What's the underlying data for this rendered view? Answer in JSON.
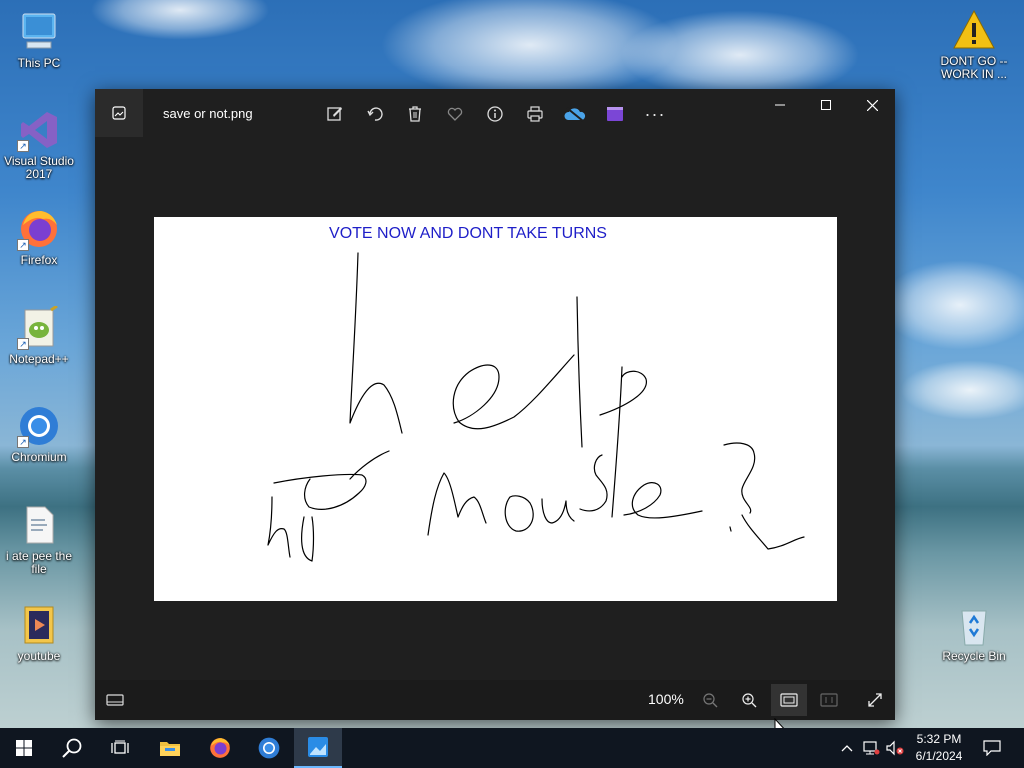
{
  "desktop": {
    "icons_left": [
      {
        "label": "This PC"
      },
      {
        "label": "Visual Studio 2017"
      },
      {
        "label": "Firefox"
      },
      {
        "label": "Notepad++"
      },
      {
        "label": "Chromium"
      },
      {
        "label": "i ate pee the file"
      },
      {
        "label": "youtube"
      }
    ],
    "icons_right": [
      {
        "label": "DONT GO -- WORK IN ..."
      },
      {
        "label": "Recycle Bin"
      }
    ]
  },
  "photos_window": {
    "file_name": "save or not.png",
    "toolbar_icons": [
      "edit-create-icon",
      "rotate-icon",
      "delete-icon",
      "favorite-icon",
      "info-icon",
      "print-icon",
      "onedrive-icon",
      "video-editor-icon",
      "more-icon"
    ],
    "more_label": "···",
    "image": {
      "heading": "VOTE NOW AND DONT TAKE TURNS",
      "handwriting": [
        "help",
        "nor mouse?"
      ]
    },
    "zoom_label": "100%"
  },
  "taskbar": {
    "clock_time": "5:32 PM",
    "clock_date": "6/1/2024"
  }
}
